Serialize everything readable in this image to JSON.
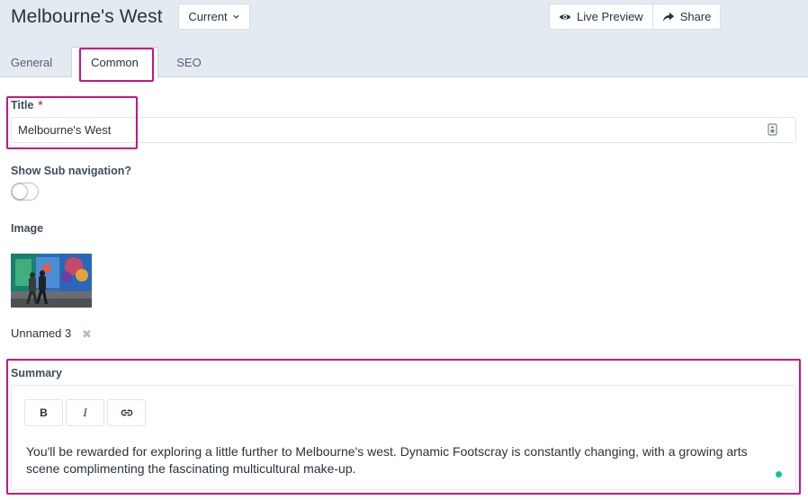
{
  "header": {
    "title": "Melbourne's West",
    "version_label": "Current",
    "live_preview_label": "Live Preview",
    "share_label": "Share"
  },
  "tabs": [
    {
      "label": "General",
      "active": false
    },
    {
      "label": "Common",
      "active": true
    },
    {
      "label": "SEO",
      "active": false
    }
  ],
  "fields": {
    "title": {
      "label": "Title",
      "required_mark": "*",
      "value": "Melbourne's West"
    },
    "subnav": {
      "label": "Show Sub navigation?",
      "enabled": false
    },
    "image": {
      "label": "Image",
      "filename": "Unnamed 3",
      "remove_glyph": "✖"
    },
    "summary": {
      "label": "Summary",
      "toolbar": {
        "bold": "B",
        "italic": "I"
      },
      "text": "You'll be rewarded for exploring a little further to Melbourne's west. Dynamic Footscray is constantly changing, with a growing arts scene complimenting the fascinating multicultural make-up."
    }
  },
  "colors": {
    "highlight": "#cc1480",
    "status_ok": "#10c98b",
    "required": "#e4342c"
  },
  "icons": [
    "chevron-down-icon",
    "eye-icon",
    "share-arrow-icon",
    "field-info-icon",
    "link-icon",
    "remove-icon"
  ]
}
